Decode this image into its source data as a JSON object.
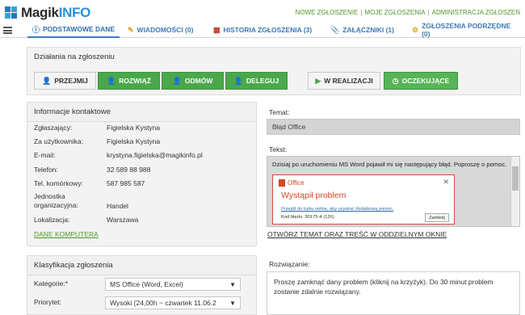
{
  "app": {
    "logo_prefix": "Magik",
    "logo_suffix": "INFO"
  },
  "top_nav": [
    {
      "label": "NOWE ZGŁOSZENIE"
    },
    {
      "label": "MOJE ZGŁOSZENIA"
    },
    {
      "label": "ADMINISTRACJA ZGŁOSZEŃ"
    }
  ],
  "tabs": [
    {
      "label": "PODSTAWOWE DANE",
      "icon": "info-icon",
      "active": true
    },
    {
      "label": "WIADOMOŚCI (0)",
      "icon": "pencil-icon"
    },
    {
      "label": "HISTORIA ZGŁOSZENIA (3)",
      "icon": "calendar-icon"
    },
    {
      "label": "ZAŁĄCZNIKI (1)",
      "icon": "paperclip-icon"
    },
    {
      "label": "ZGŁOSZENIA PODRZĘDNE (0)",
      "icon": "subtasks-icon"
    }
  ],
  "actions": {
    "title": "Działania na zgłoszeniu",
    "buttons": [
      {
        "label": "PRZEJMIJ",
        "icon": "user-icon",
        "style": "grey"
      },
      {
        "label": "ROZWIĄŻ",
        "icon": "user-check-icon",
        "style": "green"
      },
      {
        "label": "ODMÓW",
        "icon": "user-x-icon",
        "style": "green"
      },
      {
        "label": "DELEGUJ",
        "icon": "user-arrow-icon",
        "style": "green"
      }
    ],
    "status_buttons": [
      {
        "label": "W REALIZACJI",
        "icon": "play-icon",
        "style": "grey"
      },
      {
        "label": "OCZEKUJĄCE",
        "icon": "clock-icon",
        "style": "green"
      }
    ]
  },
  "contact": {
    "title": "Informacje kontaktowe",
    "rows": [
      {
        "label": "Zgłaszający:",
        "value": "Figielska Kystyna"
      },
      {
        "label": "Za użytkownika:",
        "value": "Figielska Kystyna"
      },
      {
        "label": "E-mail:",
        "value": "krystyna.figielska@magikinfo.pl"
      },
      {
        "label": "Telefon:",
        "value": "32 589 88 988"
      },
      {
        "label": "Tel. komórkowy:",
        "value": "587 985 587"
      },
      {
        "label": "Jednostka organizacyjna:",
        "value": "Handel"
      },
      {
        "label": "Lokalizacja:",
        "value": "Warszawa"
      }
    ],
    "computer_link": "DANE KOMPUTERA"
  },
  "classification": {
    "title": "Klasyfikacja zgłoszenia",
    "category_label": "Kategorie:*",
    "category_value": "MS Office (Word, Excel)",
    "priority_label": "Priorytet:",
    "priority_value": "Wysoki (24,00h ~ czwartek 11.06.2"
  },
  "subject": {
    "label": "Temat:",
    "value": "Błąd Office"
  },
  "text": {
    "label": "Tekst:",
    "line": "Dzisiaj po uruchomieniu MS Word pojawił mi się następujący błąd. Poproszę o pomoc.",
    "dialog": {
      "brand": "Office",
      "title": "Wystąpił problem",
      "link": "Przejdź do trybu online, aby uzyskać dodatkową pomoc.",
      "code": "Kod błędu: 30175-4 (126)",
      "button": "Zamknij"
    },
    "open_link": "OTWÓRZ TEMAT ORAZ TREŚĆ W ODDZIELNYM OKNIE"
  },
  "solution": {
    "label": "Rozwiązanie:",
    "value": "Proszę zamknąć dany problem (kliknij na krzyżyk). Do 30 minut problem zostanie zdalnie rozwiązany."
  },
  "colors": {
    "green": "#4aa84b",
    "blue": "#2f6eb1",
    "office_red": "#d24726"
  }
}
